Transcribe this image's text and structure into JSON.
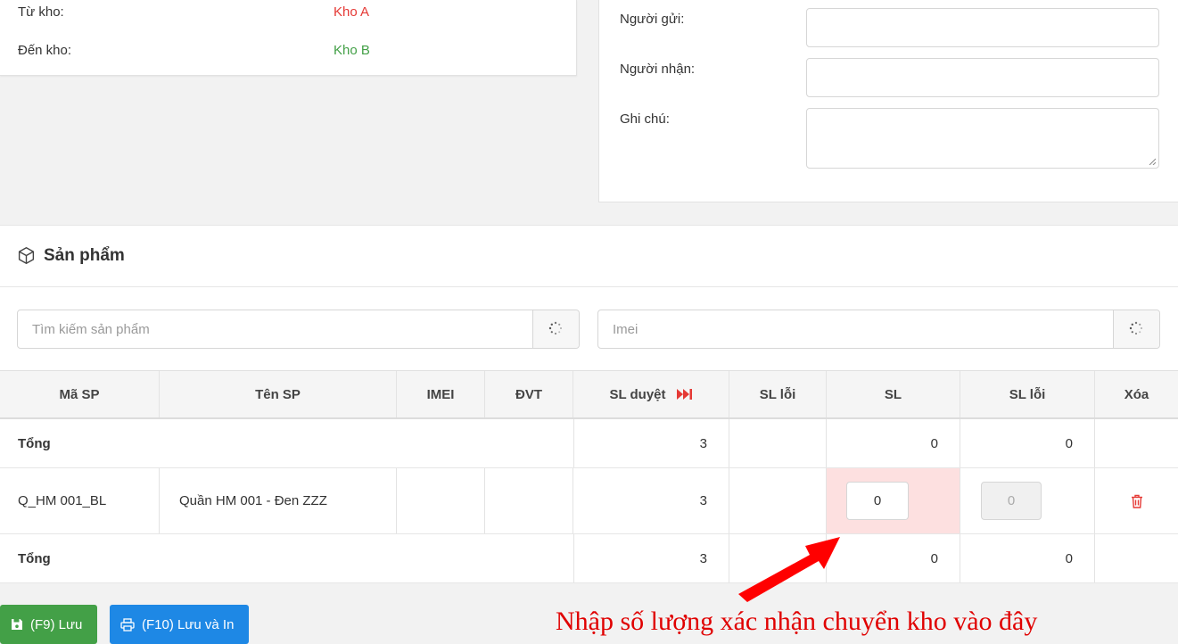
{
  "transfer": {
    "from_label": "Từ kho:",
    "from_value": "Kho A",
    "to_label": "Đến kho:",
    "to_value": "Kho B"
  },
  "form": {
    "sender_label": "Người gửi:",
    "sender_value": "",
    "receiver_label": "Người nhận:",
    "receiver_value": "",
    "note_label": "Ghi chú:",
    "note_value": ""
  },
  "products": {
    "title": "Sản phẩm",
    "search_placeholder": "Tìm kiếm sản phẩm",
    "imei_placeholder": "Imei"
  },
  "table": {
    "headers": [
      "Mã SP",
      "Tên SP",
      "IMEI",
      "ĐVT",
      "SL duyệt",
      "SL lỗi",
      "SL",
      "SL lỗi",
      "Xóa"
    ],
    "total_top": {
      "label": "Tổng",
      "sl_duyet": "3",
      "sl": "0",
      "sl_loi": "0"
    },
    "rows": [
      {
        "code": "Q_HM 001_BL",
        "name": "Quần HM 001 - Đen ZZZ",
        "imei": "",
        "dvt": "",
        "sl_duyet": "3",
        "sl_loi_duyet": "",
        "sl": "0",
        "sl_loi": "0"
      }
    ],
    "total_bottom": {
      "label": "Tổng",
      "sl_duyet": "3",
      "sl": "0",
      "sl_loi": "0"
    }
  },
  "buttons": {
    "save": "(F9) Lưu",
    "save_print": "(F10) Lưu và In"
  },
  "annotation": "Nhập số lượng xác nhận chuyển kho vào đây",
  "colors": {
    "from": "#e53935",
    "to": "#43a047",
    "save_button": "#43a047",
    "print_button": "#1e88e5",
    "highlight_cell": "#fde0e0",
    "delete_icon": "#e53935",
    "annotation": "#e00000"
  },
  "icons": {
    "section": "box-icon",
    "search_loader": "spinner-icon",
    "approve_all": "fast-forward-icon",
    "delete": "trash-icon",
    "save": "floppy-disk-icon",
    "print": "printer-icon"
  }
}
